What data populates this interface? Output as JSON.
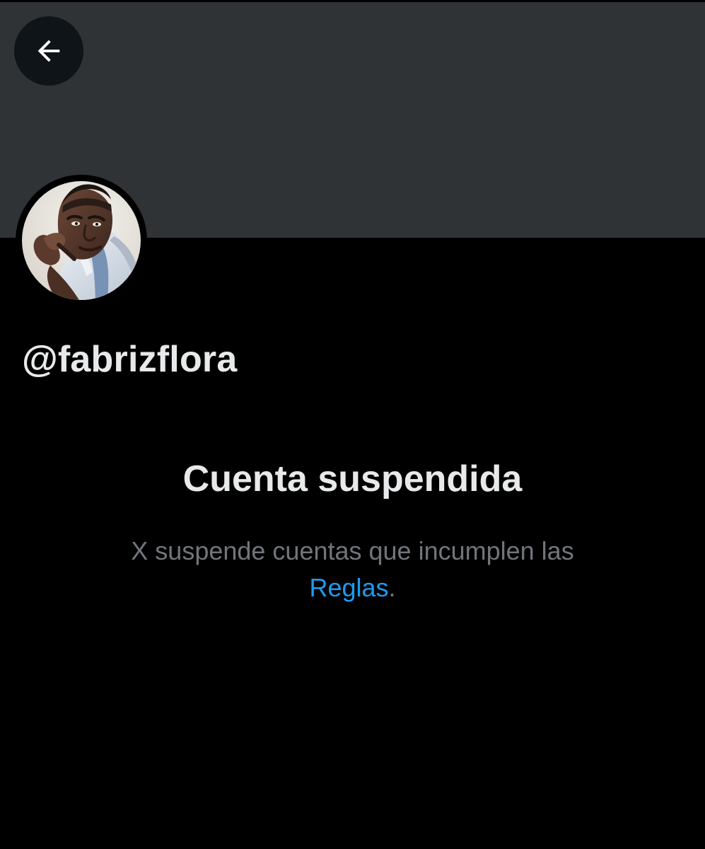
{
  "header": {
    "back_icon": "arrow-left-icon"
  },
  "profile": {
    "avatar_alt": "",
    "handle": "@fabrizflora"
  },
  "suspension": {
    "title": "Cuenta suspendida",
    "message": "X suspende cuentas que incumplen las",
    "link_label": "Reglas",
    "period": "."
  },
  "colors": {
    "banner": "#2f3336",
    "background": "#000000",
    "primary_text": "#e7e9ea",
    "secondary_text": "#71767b",
    "link": "#1d9bf0"
  }
}
